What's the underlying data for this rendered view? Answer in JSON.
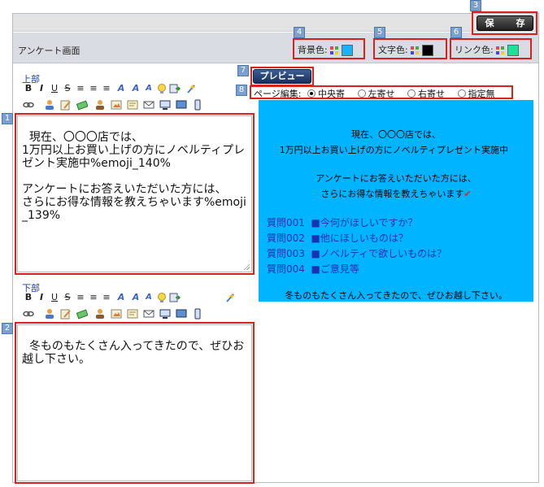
{
  "toolbar": {
    "save_label": "保　存"
  },
  "header": {
    "title": "アンケート画面",
    "bg_color_label": "背景色:",
    "text_color_label": "文字色:",
    "link_color_label": "リンク色:"
  },
  "colors": {
    "background": "#1ab2ff",
    "text": "#000000",
    "link": "#19e39a",
    "highlight_border": "#d9211e",
    "tag_bg": "#7aa0cf"
  },
  "markers": [
    "1",
    "2",
    "3",
    "4",
    "5",
    "6",
    "7",
    "8"
  ],
  "editor": {
    "upper_label": "上部",
    "lower_label": "下部",
    "upper_text": "現在、〇〇〇店では、\n1万円以上お買い上げの方にノベルティプレゼント実施中%emoji_140%\n\nアンケートにお答えいただいた方には、\nさらにお得な情報を教えちゃいます%emoji_139%",
    "lower_text": "冬ものもたくさん入ってきたので、ぜひお越し下さい。",
    "toolbar_row1": [
      "bold-icon",
      "italic-icon",
      "underline-icon",
      "strike-icon",
      "align-left-icon",
      "align-center-icon",
      "align-right-icon",
      "font-color-icon",
      "font-size-up-icon",
      "font-size-down-icon",
      "bulb-icon",
      "insert-icon",
      "blink-icon"
    ],
    "toolbar_row2": [
      "link-icon",
      "user-icon",
      "edit-icon",
      "coupon-icon",
      "member-icon",
      "image-icon",
      "form-icon",
      "mail-icon",
      "display-icon",
      "monitor-icon",
      "mobile-icon"
    ]
  },
  "preview": {
    "button_label": "プレビュー",
    "layout_label": "ページ編集:",
    "options": [
      "中央寄",
      "左寄せ",
      "右寄せ",
      "指定無"
    ],
    "selected": "中央寄",
    "line1": "現在、〇〇〇店では、",
    "line2": "1万円以上お買い上げの方にノベルティプレゼント実施中",
    "line3": "アンケートにお答えいただいた方には、",
    "line4": "さらにお得な情報を教えちゃいます",
    "questions": [
      {
        "no": "質問001",
        "text": "■今何がほしいですか？"
      },
      {
        "no": "質問002",
        "text": "■他にほしいものは？"
      },
      {
        "no": "質問003",
        "text": "■ノベルティで欲しいものは？"
      },
      {
        "no": "質問004",
        "text": "■ご意見等"
      }
    ],
    "footer": "冬ものもたくさん入ってきたので、ぜひお越し下さい。"
  }
}
